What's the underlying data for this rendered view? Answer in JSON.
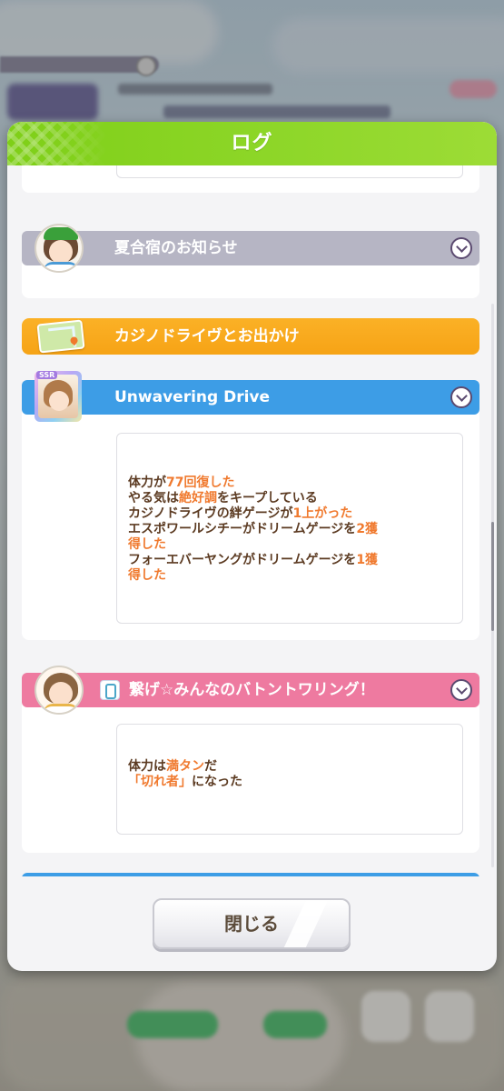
{
  "dialog": {
    "title": "ログ",
    "close_label": "閉じる"
  },
  "log": [
    {
      "kind": "event",
      "title": "夏合宿のお知らせ",
      "header_color": "#b3b2c2",
      "icon": "character-avatar-icon",
      "lines": []
    },
    {
      "kind": "outing",
      "title": "カジノドライヴとお出かけ",
      "header_color": "#f8aa1d",
      "icon": "map-icon"
    },
    {
      "kind": "support-card",
      "title": "Unwavering Drive",
      "header_color": "#3d9de6",
      "icon": "ssr-support-card-icon",
      "badge": "SSR",
      "lines": [
        [
          {
            "t": "体力が"
          },
          {
            "t": "77回復した",
            "hl": true
          }
        ],
        [
          {
            "t": "やる気は"
          },
          {
            "t": "絶好調",
            "hl": true
          },
          {
            "t": "をキープしている"
          }
        ],
        [
          {
            "t": "カジノドライヴの絆ゲージが"
          },
          {
            "t": "1上がった",
            "hl": true
          }
        ],
        [
          {
            "t": "エスポワールシチーがドリームゲージを"
          },
          {
            "t": "2獲",
            "hl": true
          }
        ],
        [
          {
            "t": "得した",
            "hl": true
          }
        ],
        [
          {
            "t": "フォーエバーヤングがドリームゲージを"
          },
          {
            "t": "1獲",
            "hl": true
          }
        ],
        [
          {
            "t": "得した",
            "hl": true
          }
        ]
      ]
    },
    {
      "kind": "skill",
      "title": "繋げ☆みんなのバトントワリング！",
      "header_color": "#ee7aa0",
      "icon": "character-avatar-icon",
      "lines": [
        [
          {
            "t": "体力は"
          },
          {
            "t": "満タン",
            "hl": true
          },
          {
            "t": "だ"
          }
        ],
        [
          {
            "t": "「切れ者」",
            "hl": true
          },
          {
            "t": "になった"
          }
        ]
      ]
    }
  ],
  "colors": {
    "header_green": "#8fd72a",
    "highlight_orange": "#f07a2f",
    "text_brown": "#5c3b22"
  }
}
